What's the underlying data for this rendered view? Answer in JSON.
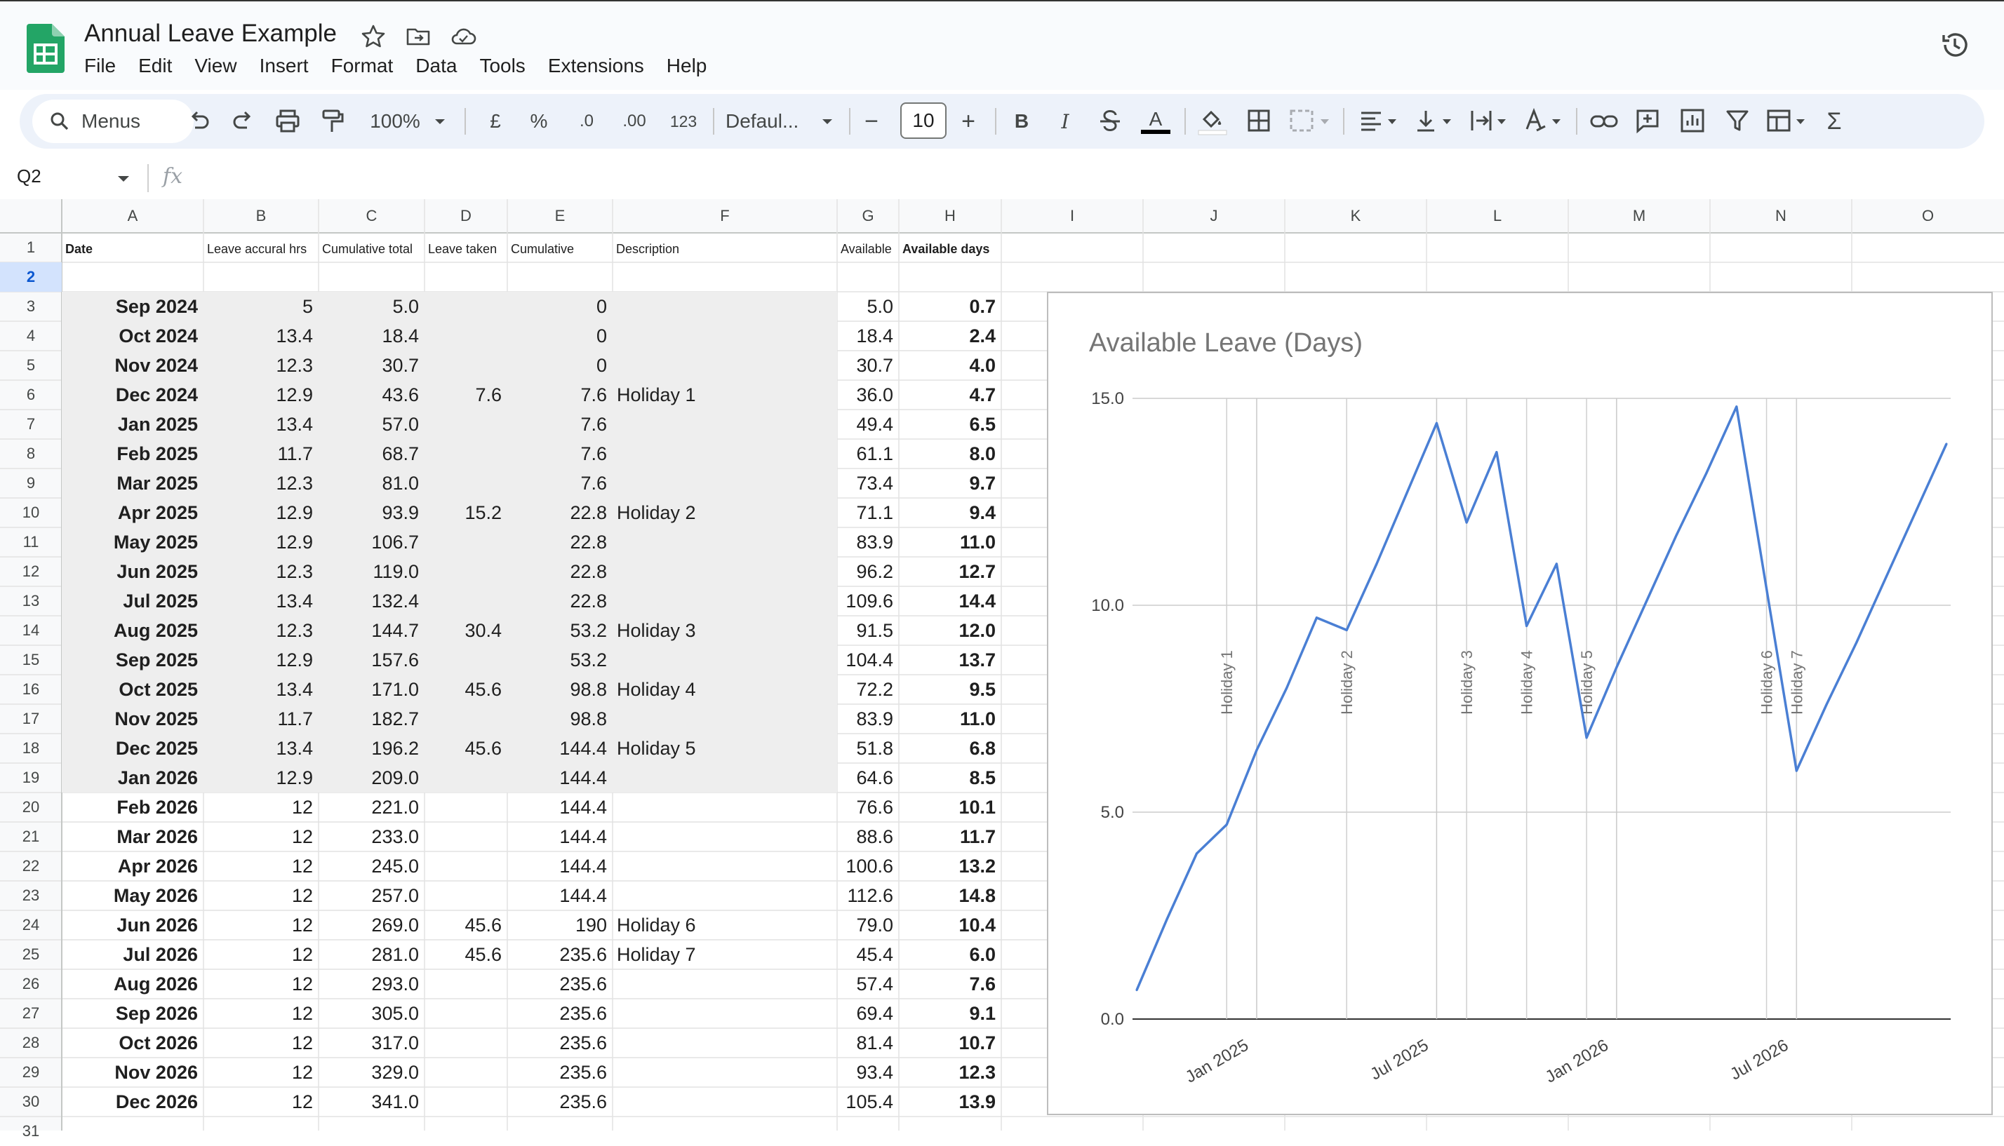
{
  "app": {
    "doc_title": "Annual Leave Example",
    "menus": [
      "File",
      "Edit",
      "View",
      "Insert",
      "Format",
      "Data",
      "Tools",
      "Extensions",
      "Help"
    ]
  },
  "toolbar": {
    "search_label": "Menus",
    "zoom": "100%",
    "currency": "£",
    "percent": "%",
    "dec_decrease": ".0",
    "dec_increase": ".00",
    "number_format": "123",
    "font": "Defaul...",
    "minus": "−",
    "font_size": "10",
    "plus": "+",
    "bold": "B",
    "italic": "I",
    "text_color": "A",
    "sigma": "Σ"
  },
  "formula_bar": {
    "name_box": "Q2",
    "fx": "fx"
  },
  "grid": {
    "columns": [
      "A",
      "B",
      "C",
      "D",
      "E",
      "F",
      "G",
      "H",
      "I",
      "J",
      "K",
      "L",
      "M",
      "N",
      "O"
    ],
    "row_numbers": [
      "1",
      "2",
      "3",
      "4",
      "5",
      "6",
      "7",
      "8",
      "9",
      "10",
      "11",
      "12",
      "13",
      "14",
      "15",
      "16",
      "17",
      "18",
      "19",
      "20",
      "21",
      "22",
      "23",
      "24",
      "25",
      "26",
      "27",
      "28",
      "29",
      "30",
      "31"
    ],
    "headers": {
      "a": "Date",
      "b": "Leave accural hrs",
      "c": "Cumulative total",
      "d": "Leave taken",
      "e": "Cumulative",
      "f": "Description",
      "g": "Available",
      "h": "Available days"
    },
    "rows": [
      {
        "a": "Sep 2024",
        "b": "5",
        "c": "5.0",
        "d": "",
        "e": "0",
        "f": "",
        "g": "5.0",
        "h": "0.7"
      },
      {
        "a": "Oct 2024",
        "b": "13.4",
        "c": "18.4",
        "d": "",
        "e": "0",
        "f": "",
        "g": "18.4",
        "h": "2.4"
      },
      {
        "a": "Nov 2024",
        "b": "12.3",
        "c": "30.7",
        "d": "",
        "e": "0",
        "f": "",
        "g": "30.7",
        "h": "4.0"
      },
      {
        "a": "Dec 2024",
        "b": "12.9",
        "c": "43.6",
        "d": "7.6",
        "e": "7.6",
        "f": "Holiday 1",
        "g": "36.0",
        "h": "4.7"
      },
      {
        "a": "Jan 2025",
        "b": "13.4",
        "c": "57.0",
        "d": "",
        "e": "7.6",
        "f": "",
        "g": "49.4",
        "h": "6.5"
      },
      {
        "a": "Feb 2025",
        "b": "11.7",
        "c": "68.7",
        "d": "",
        "e": "7.6",
        "f": "",
        "g": "61.1",
        "h": "8.0"
      },
      {
        "a": "Mar 2025",
        "b": "12.3",
        "c": "81.0",
        "d": "",
        "e": "7.6",
        "f": "",
        "g": "73.4",
        "h": "9.7"
      },
      {
        "a": "Apr 2025",
        "b": "12.9",
        "c": "93.9",
        "d": "15.2",
        "e": "22.8",
        "f": "Holiday 2",
        "g": "71.1",
        "h": "9.4"
      },
      {
        "a": "May 2025",
        "b": "12.9",
        "c": "106.7",
        "d": "",
        "e": "22.8",
        "f": "",
        "g": "83.9",
        "h": "11.0"
      },
      {
        "a": "Jun 2025",
        "b": "12.3",
        "c": "119.0",
        "d": "",
        "e": "22.8",
        "f": "",
        "g": "96.2",
        "h": "12.7"
      },
      {
        "a": "Jul 2025",
        "b": "13.4",
        "c": "132.4",
        "d": "",
        "e": "22.8",
        "f": "",
        "g": "109.6",
        "h": "14.4"
      },
      {
        "a": "Aug 2025",
        "b": "12.3",
        "c": "144.7",
        "d": "30.4",
        "e": "53.2",
        "f": "Holiday 3",
        "g": "91.5",
        "h": "12.0"
      },
      {
        "a": "Sep 2025",
        "b": "12.9",
        "c": "157.6",
        "d": "",
        "e": "53.2",
        "f": "",
        "g": "104.4",
        "h": "13.7"
      },
      {
        "a": "Oct 2025",
        "b": "13.4",
        "c": "171.0",
        "d": "45.6",
        "e": "98.8",
        "f": "Holiday 4",
        "g": "72.2",
        "h": "9.5"
      },
      {
        "a": "Nov 2025",
        "b": "11.7",
        "c": "182.7",
        "d": "",
        "e": "98.8",
        "f": "",
        "g": "83.9",
        "h": "11.0"
      },
      {
        "a": "Dec 2025",
        "b": "13.4",
        "c": "196.2",
        "d": "45.6",
        "e": "144.4",
        "f": "Holiday 5",
        "g": "51.8",
        "h": "6.8"
      },
      {
        "a": "Jan 2026",
        "b": "12.9",
        "c": "209.0",
        "d": "",
        "e": "144.4",
        "f": "",
        "g": "64.6",
        "h": "8.5"
      },
      {
        "a": "Feb 2026",
        "b": "12",
        "c": "221.0",
        "d": "",
        "e": "144.4",
        "f": "",
        "g": "76.6",
        "h": "10.1"
      },
      {
        "a": "Mar 2026",
        "b": "12",
        "c": "233.0",
        "d": "",
        "e": "144.4",
        "f": "",
        "g": "88.6",
        "h": "11.7"
      },
      {
        "a": "Apr 2026",
        "b": "12",
        "c": "245.0",
        "d": "",
        "e": "144.4",
        "f": "",
        "g": "100.6",
        "h": "13.2"
      },
      {
        "a": "May 2026",
        "b": "12",
        "c": "257.0",
        "d": "",
        "e": "144.4",
        "f": "",
        "g": "112.6",
        "h": "14.8"
      },
      {
        "a": "Jun 2026",
        "b": "12",
        "c": "269.0",
        "d": "45.6",
        "e": "190",
        "f": "Holiday 6",
        "g": "79.0",
        "h": "10.4"
      },
      {
        "a": "Jul 2026",
        "b": "12",
        "c": "281.0",
        "d": "45.6",
        "e": "235.6",
        "f": "Holiday 7",
        "g": "45.4",
        "h": "6.0"
      },
      {
        "a": "Aug 2026",
        "b": "12",
        "c": "293.0",
        "d": "",
        "e": "235.6",
        "f": "",
        "g": "57.4",
        "h": "7.6"
      },
      {
        "a": "Sep 2026",
        "b": "12",
        "c": "305.0",
        "d": "",
        "e": "235.6",
        "f": "",
        "g": "69.4",
        "h": "9.1"
      },
      {
        "a": "Oct 2026",
        "b": "12",
        "c": "317.0",
        "d": "",
        "e": "235.6",
        "f": "",
        "g": "81.4",
        "h": "10.7"
      },
      {
        "a": "Nov 2026",
        "b": "12",
        "c": "329.0",
        "d": "",
        "e": "235.6",
        "f": "",
        "g": "93.4",
        "h": "12.3"
      },
      {
        "a": "Dec 2026",
        "b": "12",
        "c": "341.0",
        "d": "",
        "e": "235.6",
        "f": "",
        "g": "105.4",
        "h": "13.9"
      }
    ]
  },
  "colors": {
    "accent": "#4a7fd4",
    "row_shade": "#eeeeee",
    "sheets_green": "#23a566",
    "toolbar_bg": "#edf2fa"
  },
  "chart_data": {
    "type": "line",
    "title": "Available Leave (Days)",
    "x": [
      "2024-09",
      "2024-10",
      "2024-11",
      "2024-12",
      "2025-01",
      "2025-02",
      "2025-03",
      "2025-04",
      "2025-05",
      "2025-06",
      "2025-07",
      "2025-08",
      "2025-09",
      "2025-10",
      "2025-11",
      "2025-12",
      "2026-01",
      "2026-02",
      "2026-03",
      "2026-04",
      "2026-05",
      "2026-06",
      "2026-07",
      "2026-08",
      "2026-09",
      "2026-10",
      "2026-11",
      "2026-12"
    ],
    "series": [
      {
        "values": [
          0.7,
          2.4,
          4.0,
          4.7,
          6.5,
          8.0,
          9.7,
          9.4,
          11.0,
          12.7,
          14.4,
          12.0,
          13.7,
          9.5,
          11.0,
          6.8,
          8.5,
          10.1,
          11.7,
          13.2,
          14.8,
          10.4,
          6.0,
          7.6,
          9.1,
          10.7,
          12.3,
          13.9
        ]
      }
    ],
    "annotations": [
      {
        "x": "2024-12",
        "label": "Holiday 1"
      },
      {
        "x": "2025-04",
        "label": "Holiday 2"
      },
      {
        "x": "2025-08",
        "label": "Holiday 3"
      },
      {
        "x": "2025-10",
        "label": "Holiday 4"
      },
      {
        "x": "2025-12",
        "label": "Holiday 5"
      },
      {
        "x": "2026-06",
        "label": "Holiday 6"
      },
      {
        "x": "2026-07",
        "label": "Holiday 7"
      }
    ],
    "xticks": [
      "Jan 2025",
      "Jul 2025",
      "Jan 2026",
      "Jul 2026"
    ],
    "yticks": [
      "0.0",
      "5.0",
      "10.0",
      "15.0"
    ],
    "ylim": [
      0,
      15
    ],
    "xlabel": "",
    "ylabel": "",
    "grid": true,
    "legend": "none"
  }
}
